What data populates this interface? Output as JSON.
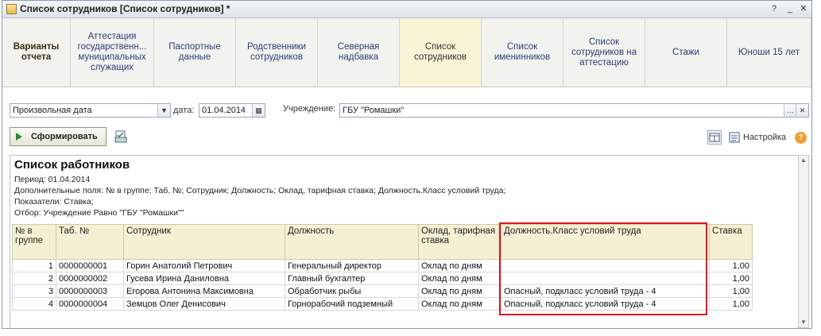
{
  "window": {
    "title": "Список сотрудников [Список сотрудников] *"
  },
  "tabs": [
    {
      "label": "Варианты отчета"
    },
    {
      "label": "Аттестация государственн... муниципальных служащих"
    },
    {
      "label": "Паспортные данные"
    },
    {
      "label": "Родственники сотрудников"
    },
    {
      "label": "Северная надбавка"
    },
    {
      "label": "Список сотрудников"
    },
    {
      "label": "Список именинников"
    },
    {
      "label": "Список сотрудников на аттестацию"
    },
    {
      "label": "Стажи"
    },
    {
      "label": "Юноши 15 лет"
    }
  ],
  "filters": {
    "period_type": "Произвольная дата",
    "date_label": "дата:",
    "date_value": "01.04.2014",
    "org_label": "Учреждение:",
    "org_value": "ГБУ \"Ромашки\""
  },
  "toolbar": {
    "generate_label": "Сформировать",
    "settings_label": "Настройка"
  },
  "report": {
    "title": "Список работников",
    "period": "Период: 01.04.2014",
    "extra_fields": "Дополнительные поля: № в группе; Таб. №; Сотрудник; Должность; Оклад, тарифная ставка; Должность.Класс условий труда;",
    "indicators": "Показатели: Ставка;",
    "selection": "Отбор: Учреждение Равно \"ГБУ \"Ромашки\"\"",
    "columns": [
      "№ в группе",
      "Таб. №",
      "Сотрудник",
      "Должность",
      "Оклад, тарифная ставка",
      "Должность.Класс условий труда",
      "Ставка"
    ],
    "rows": [
      {
        "n": "1",
        "tab": "0000000001",
        "emp": "Горин Анатолий Петрович",
        "pos": "Генеральный директор",
        "pay": "Оклад по дням",
        "cls": "",
        "rate": "1,00"
      },
      {
        "n": "2",
        "tab": "0000000002",
        "emp": "Гусева Ирина Даниловна",
        "pos": "Главный бухгалтер",
        "pay": "Оклад по дням",
        "cls": "",
        "rate": "1,00"
      },
      {
        "n": "3",
        "tab": "0000000003",
        "emp": "Егорова Антонина Максимовна",
        "pos": "Обработчик рыбы",
        "pay": "Оклад по дням",
        "cls": "Опасный, подкласс условий труда - 4",
        "rate": "1,00"
      },
      {
        "n": "4",
        "tab": "0000000004",
        "emp": "Земцов Олег Денисович",
        "pos": "Горнорабочий подземный",
        "pay": "Оклад по дням",
        "cls": "Опасный, подкласс условий труда - 4",
        "rate": "1,00"
      }
    ]
  },
  "colors": {
    "highlight_border": "#e0141e",
    "header_bg": "#f5f0d4",
    "active_tab": "#fbf3d6"
  }
}
